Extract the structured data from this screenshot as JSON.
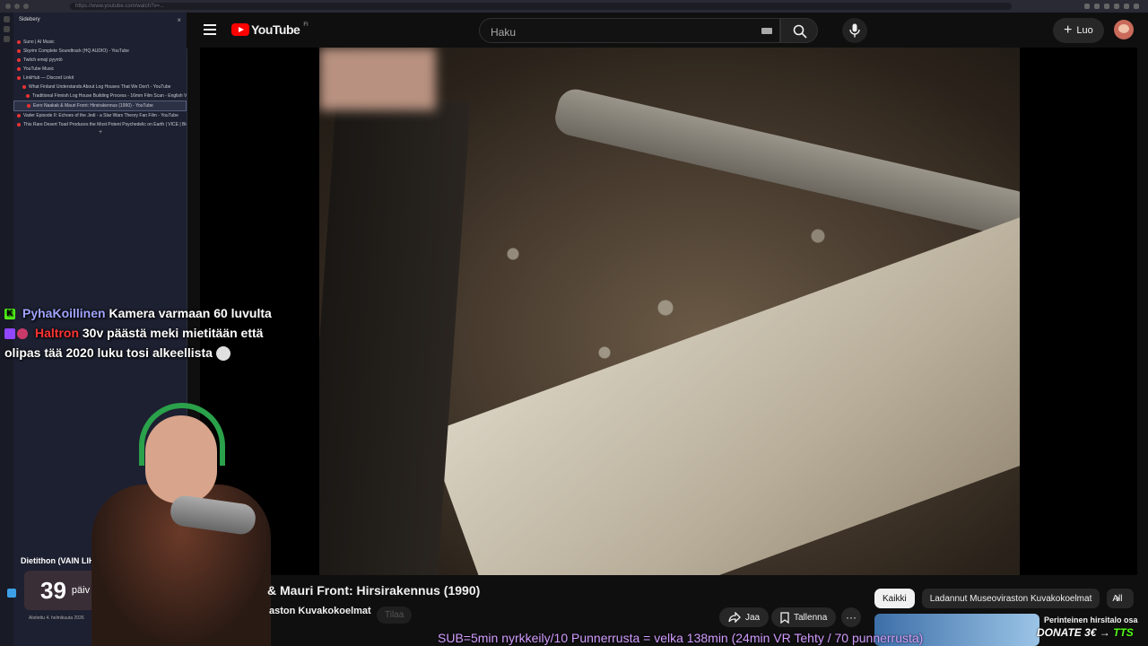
{
  "browser": {
    "url": "https://www.youtube.com/watch?v=..."
  },
  "sidebery": {
    "title": "Sidebery",
    "close_label": "×",
    "tabs": [
      {
        "label": "Suno | AI Music",
        "level": 0,
        "active": false
      },
      {
        "label": "Skyrim Complete Soundtrack (HQ AUDIO) - YouTube",
        "level": 0,
        "active": false
      },
      {
        "label": "Twitch emoji pyyntö",
        "level": 0,
        "active": false
      },
      {
        "label": "YouTube Music",
        "level": 0,
        "active": false
      },
      {
        "label": "LinkHub — Discord Linkit",
        "level": 0,
        "active": false
      },
      {
        "label": "What Finland Understands About Log Houses That We Don't - YouTube",
        "level": 1,
        "active": false
      },
      {
        "label": "Traditional Finnish Log House Building Process - 16mm Film Scan - English Ve",
        "level": 2,
        "active": false
      },
      {
        "label": "Eero Naakak & Mauri Front: Hirsirakennus (1990) - YouTube",
        "level": 2,
        "active": true
      },
      {
        "label": "Vader Episode II: Echoes of the Jedi - a Star Wars Theory Fan Film - YouTube",
        "level": 0,
        "active": false
      },
      {
        "label": "This Rare Desert Toad Produces the Most Potent Psychedelic on Earth | VICE | Bio",
        "level": 0,
        "active": false
      }
    ],
    "plus_label": "+"
  },
  "youtube": {
    "logo_text": "YouTube",
    "region": "FI",
    "search_placeholder": "Haku",
    "create_label": "Luo",
    "video_title": "& Mauri Front: Hirsirakennus (1990)",
    "channel": "aston Kuvakokoelmat",
    "subscribe_label": "Tilaa",
    "share_label": "Jaa",
    "save_label": "Tallenna",
    "more_label": "···",
    "chips": [
      "Kaikki",
      "Ladannut Museoviraston Kuvakokoelmat",
      "All"
    ],
    "next_label": "›",
    "recommended_title": "Perinteinen hirsitalo osa"
  },
  "chat": {
    "msg1_user": "PyhaKoillinen",
    "msg1_text": "Kamera varmaan 60 luvulta",
    "msg2_user": "Haltron",
    "msg2_text": "30v päästä meki mietitään että olipas tää 2020 luku tosi alkeellista"
  },
  "timer": {
    "label": "Dietithon (VAIN LIHA",
    "days": "39",
    "unit": "päiv",
    "footer": "Aloitettu 4. helmikuuta 2026"
  },
  "overlays": {
    "sub_ticker": "SUB=5min nyrkkeily/10 Punnerrusta = velka 138min (24min VR Tehty / 70 punnerrusta)",
    "donate_text": "DONATE 3€ → ",
    "donate_tts": "TTS"
  }
}
